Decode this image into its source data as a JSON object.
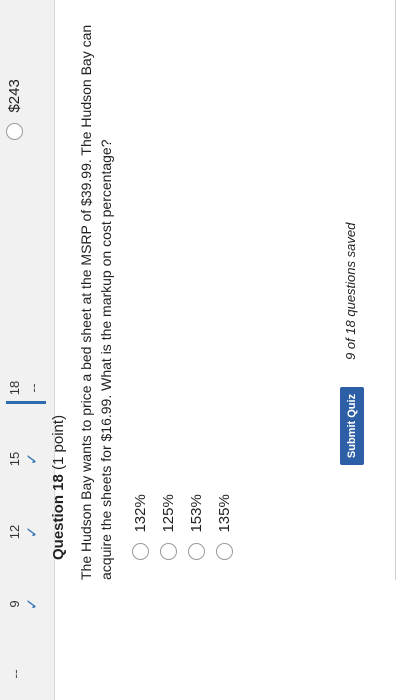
{
  "nav": {
    "items": [
      {
        "number": "",
        "mark": "--"
      },
      {
        "number": "9",
        "mark": "✓"
      },
      {
        "number": "12",
        "mark": "✓"
      },
      {
        "number": "15",
        "mark": "✓"
      },
      {
        "number": "18",
        "mark": "--"
      }
    ]
  },
  "previous_question": {
    "visible_option": "$243"
  },
  "question": {
    "title": "Question 18",
    "points": "(1 point)",
    "text": "The Hudson Bay wants to price a bed sheet at the MSRP of $39.99. The Hudson Bay can acquire the sheets for $16.99. What is the markup on cost percentage?",
    "options": [
      "132%",
      "125%",
      "153%",
      "135%"
    ]
  },
  "footer": {
    "submit_label": "Submit Quiz",
    "saved_status": "9 of 18 questions saved"
  },
  "colors": {
    "accent": "#2b6cb0",
    "button": "#2d5fa6"
  }
}
